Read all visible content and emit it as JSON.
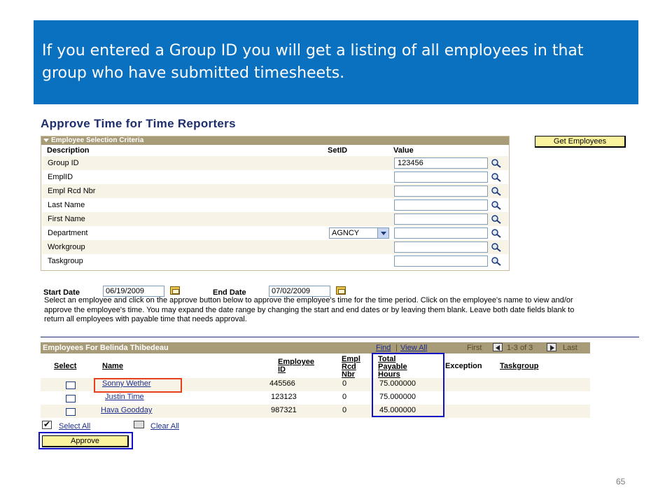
{
  "banner": {
    "text": "If you entered a Group ID you will get a listing of all employees in that group who have submitted timesheets."
  },
  "page_title": "Approve Time for Time Reporters",
  "criteria": {
    "header": "Employee Selection Criteria",
    "columns": {
      "description": "Description",
      "setid": "SetID",
      "value": "Value"
    },
    "rows": [
      {
        "label": "Group ID",
        "value": "123456"
      },
      {
        "label": "EmplID",
        "value": ""
      },
      {
        "label": "Empl Rcd Nbr",
        "value": ""
      },
      {
        "label": "Last Name",
        "value": ""
      },
      {
        "label": "First Name",
        "value": ""
      },
      {
        "label": "Department",
        "setid": "AGNCY",
        "value": ""
      },
      {
        "label": "Workgroup",
        "value": ""
      },
      {
        "label": "Taskgroup",
        "value": ""
      }
    ]
  },
  "get_employees_label": "Get Employees",
  "dates": {
    "start_label": "Start Date",
    "start_value": "06/19/2009",
    "end_label": "End Date",
    "end_value": "07/02/2009"
  },
  "instructions": "Select an employee and click on the approve button below to approve the employee's time for the time period.  Click on the employee's name to view and/or approve the employee's time.  You may expand the date range by changing the start and end dates or by leaving them blank.  Leave both date fields blank to return all employees with payable time that needs approval.",
  "grid": {
    "title": "Employees For Belinda Thibedeau",
    "nav": {
      "find": "Find",
      "sep": "|",
      "view_all": "View All",
      "first": "First",
      "range": "1-3 of 3",
      "last": "Last"
    },
    "headers": {
      "select": "Select",
      "name": "Name",
      "employee_id": [
        "Employee",
        "ID"
      ],
      "empl_rcd": [
        "Empl",
        "Rcd",
        "Nbr"
      ],
      "total_hours": [
        "Total",
        "Payable",
        "Hours"
      ],
      "exception": "Exception",
      "taskgroup": "Taskgroup"
    },
    "rows": [
      {
        "name": "Sonny Wether",
        "id": "445566",
        "rcd": "0",
        "hours": "75.000000"
      },
      {
        "name": "Justin Time",
        "id": "123123",
        "rcd": "0",
        "hours": "75.000000"
      },
      {
        "name": "Hava Goodday",
        "id": "987321",
        "rcd": "0",
        "hours": "45.000000"
      }
    ]
  },
  "select_all_label": "Select All",
  "clear_all_label": "Clear All",
  "approve_label": "Approve",
  "slide_number": "65",
  "colors": {
    "banner": "#0a70c0",
    "callout_red": "#e8401c",
    "callout_blue": "#1010c8",
    "button_yellow": "#fcf39e",
    "grid_header": "#a89b78"
  }
}
